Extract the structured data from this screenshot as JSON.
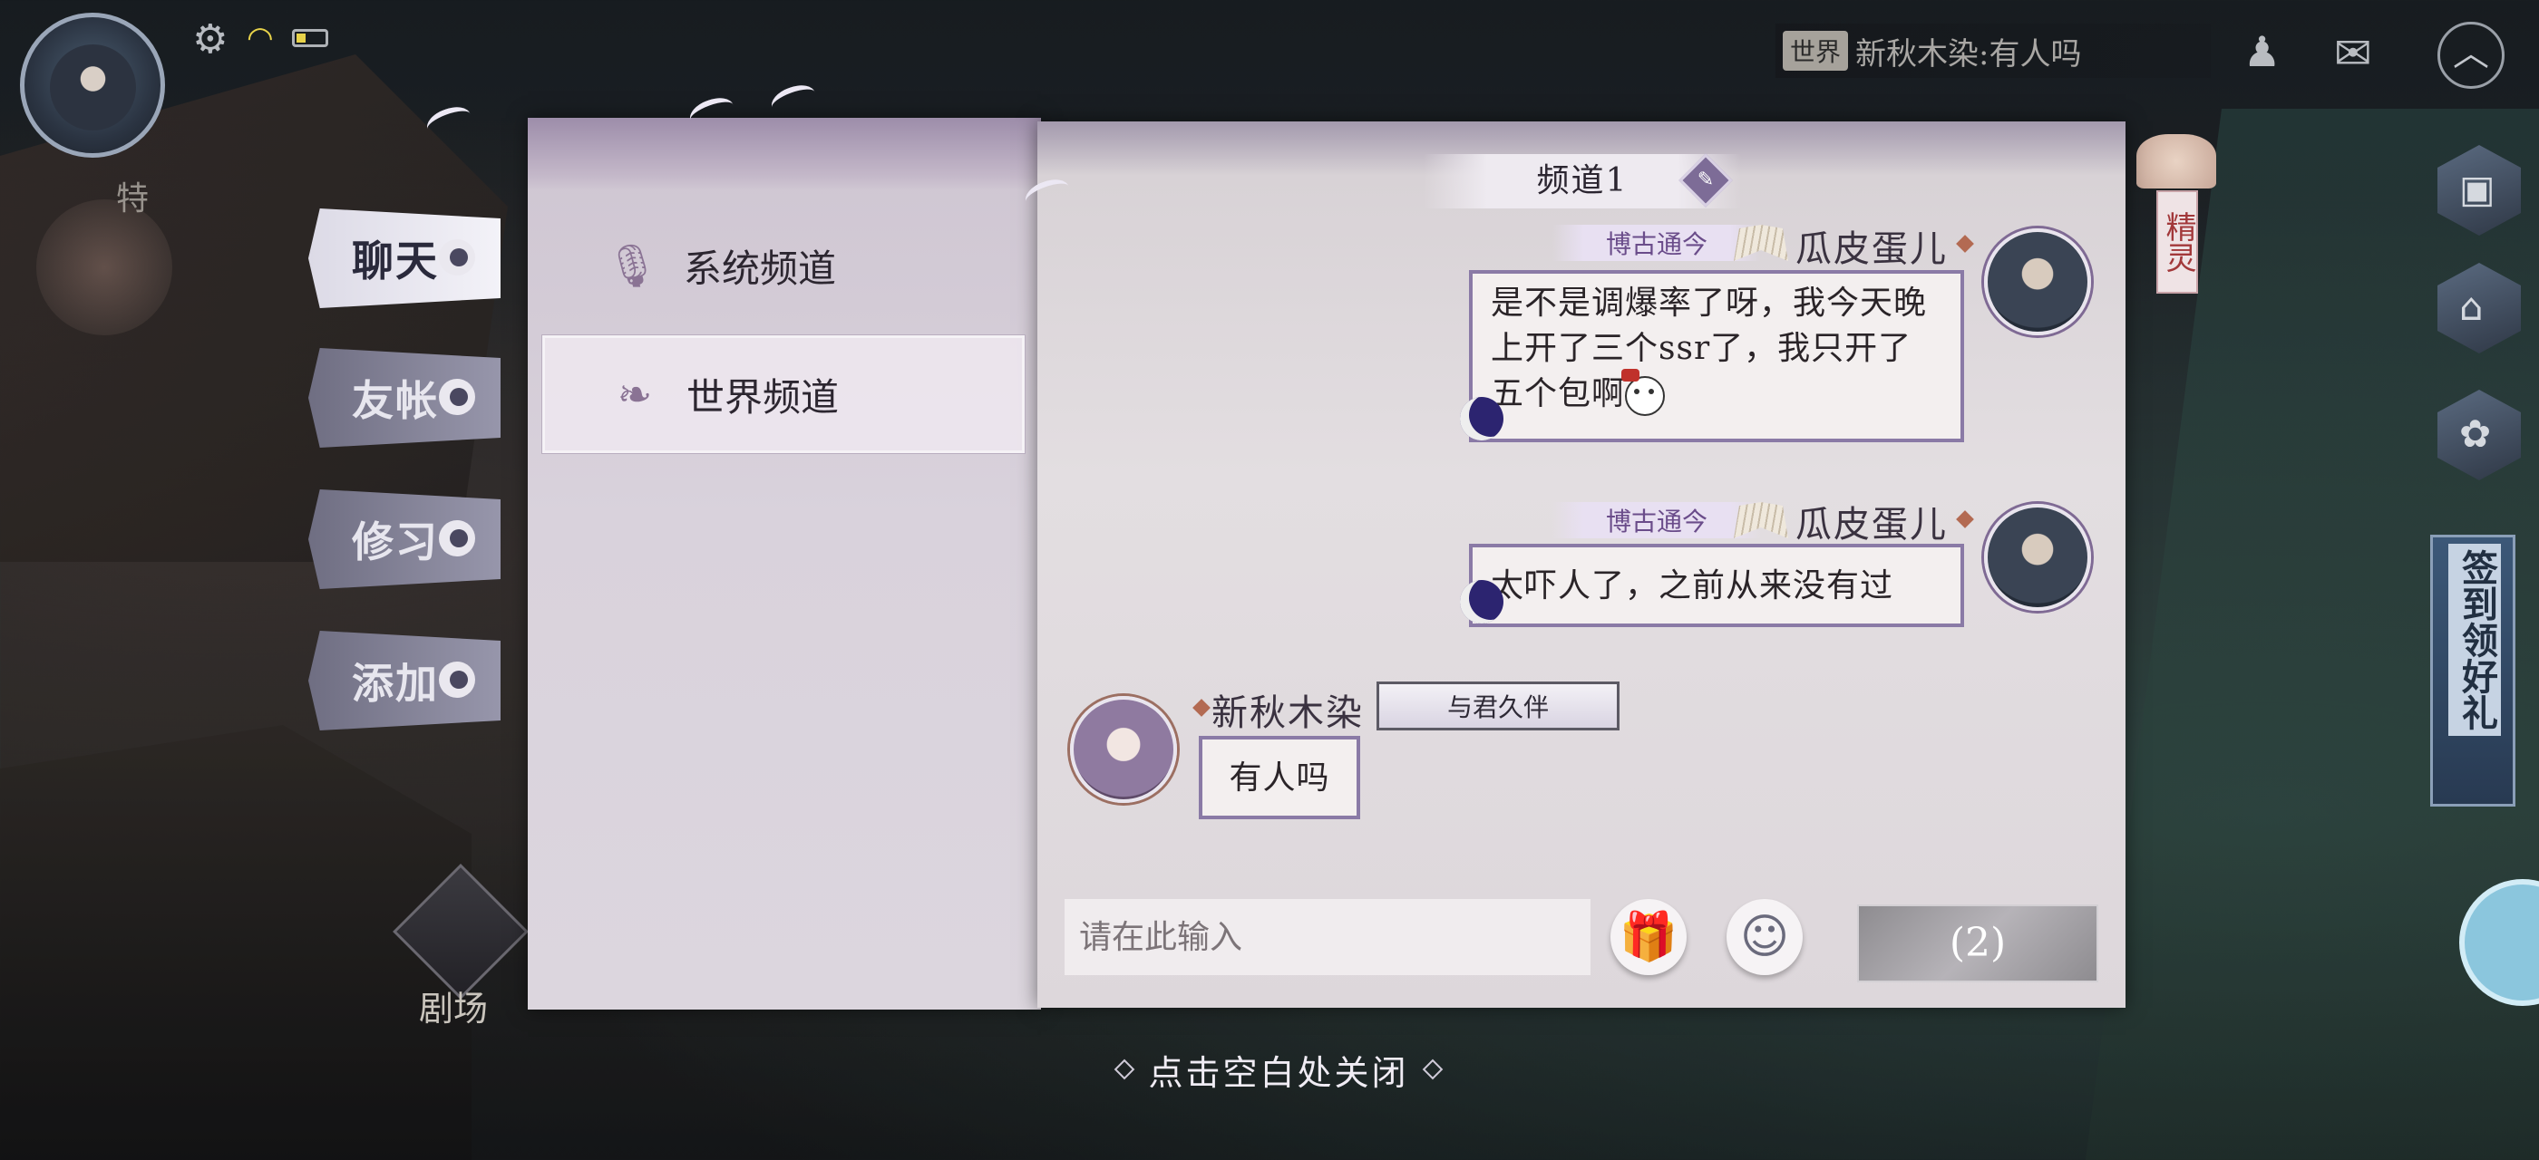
{
  "hud": {
    "side_deco_label": "特",
    "theater_label": "剧场",
    "world_tag": "世界",
    "world_latest": "新秋木染:有人吗",
    "spirit_label": "精灵",
    "signin_label": "签到领好礼"
  },
  "tabs": [
    {
      "label": "聊天",
      "active": true
    },
    {
      "label": "友帐",
      "active": false
    },
    {
      "label": "修习",
      "active": false
    },
    {
      "label": "添加",
      "active": false
    }
  ],
  "channels": [
    {
      "label": "系统频道",
      "icon": "microphone-icon",
      "selected": false
    },
    {
      "label": "世界频道",
      "icon": "feather-icon",
      "selected": true
    }
  ],
  "channel_title": "频道1",
  "messages": [
    {
      "sender": "瓜皮蛋儿",
      "title_badge": "博古通今",
      "text": "是不是调爆率了呀，我今天晚上开了三个ssr了，我只开了五个包啊",
      "side": "right"
    },
    {
      "sender": "瓜皮蛋儿",
      "title_badge": "博古通今",
      "text": "太吓人了，之前从来没有过",
      "side": "right"
    },
    {
      "sender": "新秋木染",
      "title_badge": "与君久伴",
      "text": "有人吗",
      "side": "left"
    }
  ],
  "input": {
    "placeholder": "请在此输入"
  },
  "send_button": "(2)",
  "close_hint": "点击空白处关闭",
  "colors": {
    "accent": "#8a7aa6",
    "panel": "#e3dee1",
    "tab_active": "#f3f2f8"
  }
}
